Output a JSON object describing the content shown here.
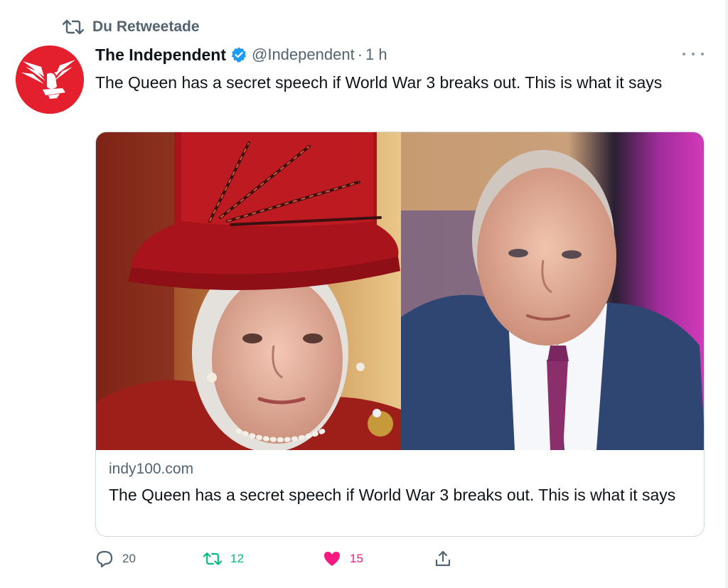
{
  "retweet_context": {
    "label": "Du Retweetade"
  },
  "author": {
    "name": "The Independent",
    "handle": "@Independent",
    "separator": "·",
    "time": "1 h",
    "verified": true,
    "avatar_icon": "independent-eagle-logo",
    "avatar_color": "#e5202e"
  },
  "tweet": {
    "text": "The Queen has a secret speech if World War 3 breaks out. This is what it says"
  },
  "card": {
    "domain": "indy100.com",
    "title": "The Queen has a secret speech if World War 3 breaks out. This is what it says"
  },
  "actions": {
    "reply_count": "20",
    "retweet_count": "12",
    "like_count": "15"
  },
  "colors": {
    "retweet_active": "#00ba7c",
    "like_active": "#f91880",
    "secondary_text": "#536471",
    "verified_blue": "#1d9bf0"
  }
}
